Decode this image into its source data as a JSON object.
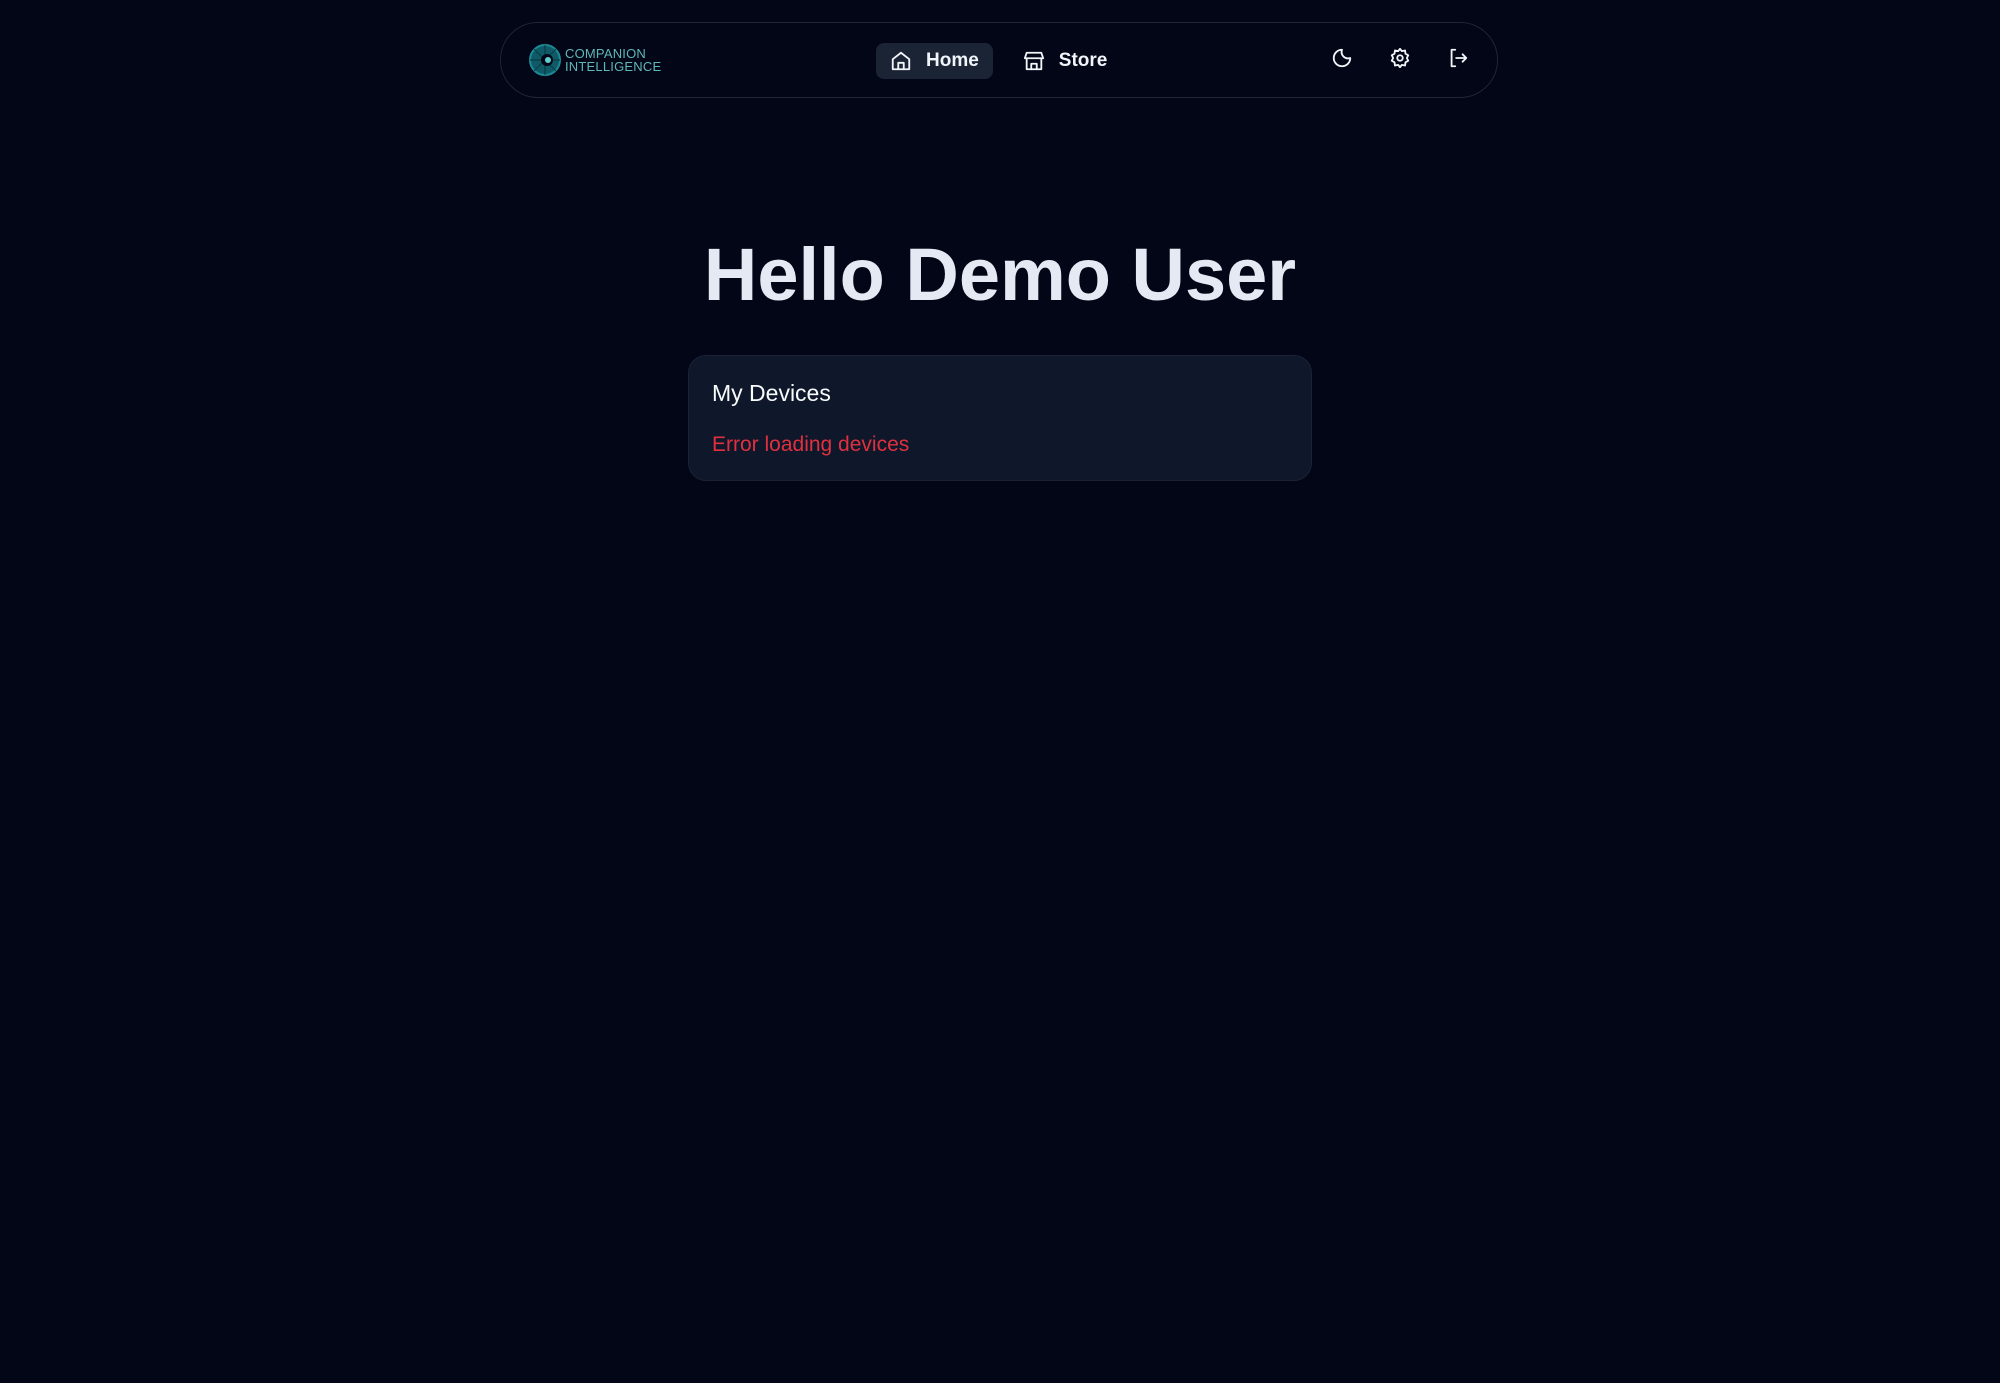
{
  "nav": {
    "logo_text": [
      "COMPANION",
      "INTELLIGENCE"
    ],
    "links": [
      {
        "label": "Home",
        "icon": "home-icon",
        "active": true
      },
      {
        "label": "Store",
        "icon": "store-icon",
        "active": false
      }
    ],
    "actions": [
      "moon-icon",
      "gear-icon",
      "logout-icon"
    ]
  },
  "main": {
    "greeting": "Hello Demo User",
    "devices_card": {
      "title": "My Devices",
      "error": "Error loading devices"
    }
  },
  "colors": {
    "background": "#030617",
    "card": "#0f172a",
    "error": "#e0303f",
    "accent": "#5fb8b8"
  }
}
